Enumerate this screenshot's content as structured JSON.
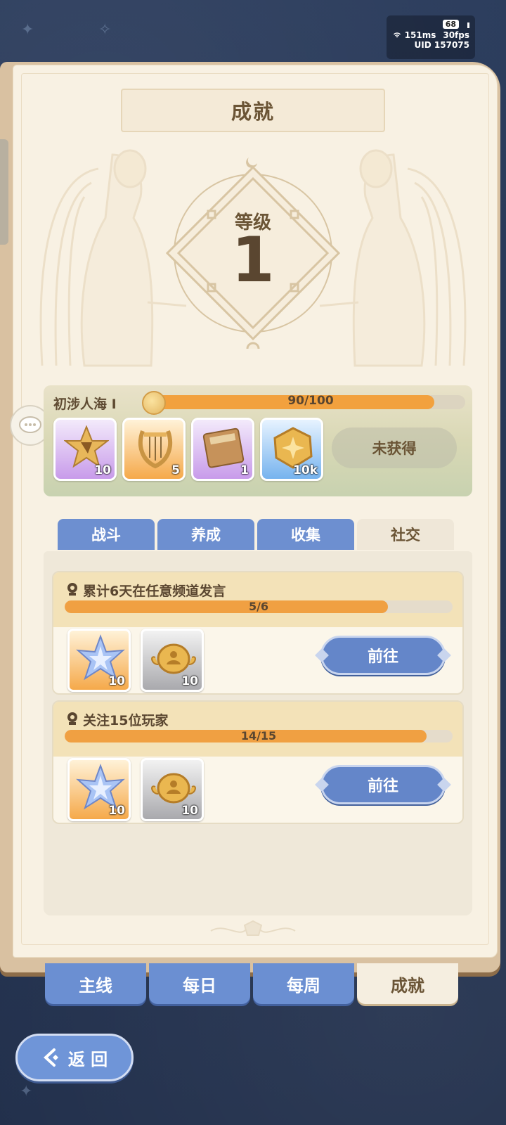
{
  "status": {
    "battery": "68",
    "ping": "151ms",
    "fps": "30fps",
    "uid": "UID 157075"
  },
  "header": {
    "title": "成就"
  },
  "level": {
    "label": "等级",
    "value": "1"
  },
  "reward": {
    "name": "初涉人海 I",
    "progress_text": "90/100",
    "progress": 0.9,
    "items": [
      {
        "icon": "star-badge-icon",
        "qty": "10",
        "rarity": "purple"
      },
      {
        "icon": "lyre-icon",
        "qty": "5",
        "rarity": "orange"
      },
      {
        "icon": "book-icon",
        "qty": "1",
        "rarity": "purple"
      },
      {
        "icon": "gold-coin-icon",
        "qty": "10k",
        "rarity": "blue"
      }
    ],
    "unobtained_label": "未获得"
  },
  "categories": [
    {
      "label": "战斗",
      "active": false
    },
    {
      "label": "养成",
      "active": false
    },
    {
      "label": "收集",
      "active": false
    },
    {
      "label": "社交",
      "active": true
    }
  ],
  "tasks": [
    {
      "title": "累计6天在任意频道发言",
      "progress_text": "5/6",
      "progress": 0.833,
      "items": [
        {
          "icon": "crystal-star-icon",
          "qty": "10",
          "rarity": "orange"
        },
        {
          "icon": "friend-coin-icon",
          "qty": "10",
          "rarity": "grey"
        }
      ],
      "button": "前往"
    },
    {
      "title": "关注15位玩家",
      "progress_text": "14/15",
      "progress": 0.933,
      "items": [
        {
          "icon": "crystal-star-icon",
          "qty": "10",
          "rarity": "orange"
        },
        {
          "icon": "friend-coin-icon",
          "qty": "10",
          "rarity": "grey"
        }
      ],
      "button": "前往"
    }
  ],
  "main_tabs": [
    {
      "label": "主线",
      "active": false
    },
    {
      "label": "每日",
      "active": false
    },
    {
      "label": "每周",
      "active": false
    },
    {
      "label": "成就",
      "active": true
    }
  ],
  "back_button": "返 回",
  "colors": {
    "tab_blue": "#6b8fd2",
    "progress_orange": "#f0a042",
    "page_cream": "#f8f1e3"
  }
}
